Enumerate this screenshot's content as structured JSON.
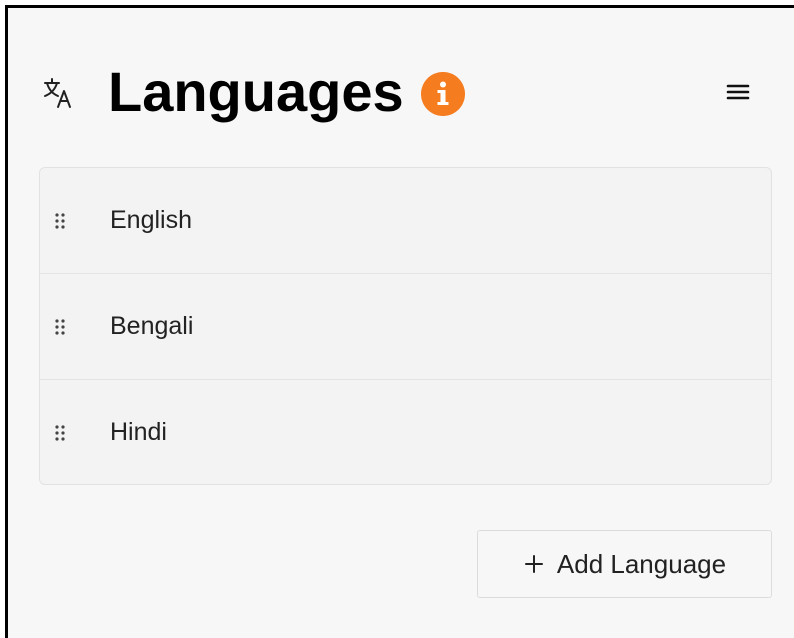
{
  "header": {
    "title": "Languages",
    "icons": {
      "translate": "translate-icon",
      "info": "info-icon",
      "menu": "hamburger-menu-icon"
    }
  },
  "languages": {
    "items": [
      {
        "label": "English",
        "handle_icon": "drag-handle-icon"
      },
      {
        "label": "Bengali",
        "handle_icon": "drag-handle-icon"
      },
      {
        "label": "Hindi",
        "handle_icon": "drag-handle-icon"
      }
    ]
  },
  "actions": {
    "add_label": "Add Language",
    "add_icon": "plus-icon"
  },
  "colors": {
    "accent": "#f57c1f",
    "text": "#000000",
    "panel": "#f3f3f3",
    "background": "#f7f7f7"
  }
}
